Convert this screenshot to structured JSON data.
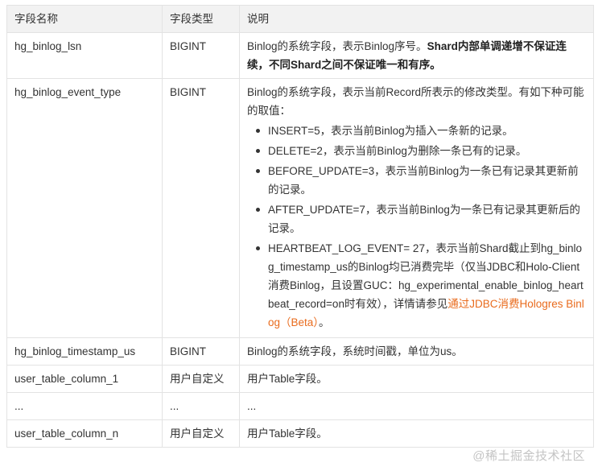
{
  "table": {
    "headers": [
      "字段名称",
      "字段类型",
      "说明"
    ],
    "rows": {
      "lsn": {
        "name": "hg_binlog_lsn",
        "type": "BIGINT",
        "desc": "Binlog的系统字段，表示Binlog序号。",
        "desc_bold": "Shard内部单调递增不保证连续，不同Shard之间不保证唯一和有序。"
      },
      "event_type": {
        "name": "hg_binlog_event_type",
        "type": "BIGINT",
        "intro": "Binlog的系统字段，表示当前Record所表示的修改类型。有如下种可能的取值：",
        "values": [
          "INSERT=5，表示当前Binlog为插入一条新的记录。",
          "DELETE=2，表示当前Binlog为删除一条已有的记录。",
          "BEFORE_UPDATE=3，表示当前Binlog为一条已有记录其更新前的记录。",
          "AFTER_UPDATE=7，表示当前Binlog为一条已有记录其更新后的记录。",
          "HEARTBEAT_LOG_EVENT= 27，表示当前Shard截止到hg_binlog_timestamp_us的Binlog均已消费完毕（仅当JDBC和Holo-Client消费Binlog，且设置GUC：hg_experimental_enable_binlog_heartbeat_record=on时有效），详情请参见"
        ],
        "link_text": "通过JDBC消费Hologres Binlog（Beta）",
        "after_link": "。"
      },
      "timestamp": {
        "name": "hg_binlog_timestamp_us",
        "type": "BIGINT",
        "desc": "Binlog的系统字段，系统时间戳，单位为us。"
      },
      "col1": {
        "name": "user_table_column_1",
        "type": "用户自定义",
        "desc": "用户Table字段。"
      },
      "ellipsis": {
        "name": "...",
        "type": "...",
        "desc": "..."
      },
      "coln": {
        "name": "user_table_column_n",
        "type": "用户自定义",
        "desc": "用户Table字段。"
      }
    }
  },
  "watermark": "@稀土掘金技术社区",
  "colors": {
    "header_bg": "#f2f2f2",
    "border": "#e3e3e3",
    "link": "#e96b1d",
    "text": "#333333"
  }
}
